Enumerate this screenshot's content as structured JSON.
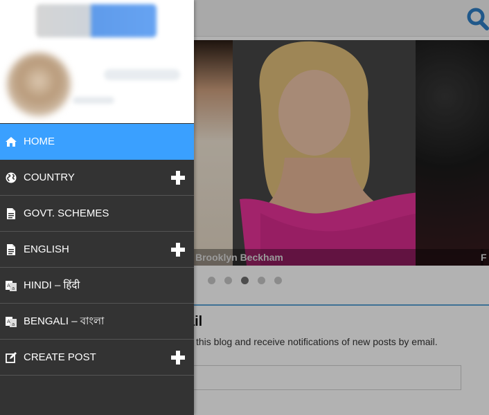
{
  "header": {
    "search_icon": "search-icon"
  },
  "slider": {
    "caption": "Brooklyn Beckham",
    "caption_next": "F",
    "dots_count": 5,
    "active_dot_index": 2
  },
  "follow": {
    "title": "ail",
    "description": "this blog and receive notifications of new posts by email.",
    "email_placeholder": ""
  },
  "drawer": {
    "menu": [
      {
        "label": "HOME",
        "icon": "home-icon",
        "active": true,
        "expandable": false
      },
      {
        "label": "COUNTRY",
        "icon": "globe-icon",
        "active": false,
        "expandable": true
      },
      {
        "label": "GOVT. SCHEMES",
        "icon": "document-icon",
        "active": false,
        "expandable": false
      },
      {
        "label": "ENGLISH",
        "icon": "document-icon",
        "active": false,
        "expandable": true
      },
      {
        "label": "HINDI – हिंदी",
        "icon": "translate-icon",
        "active": false,
        "expandable": false
      },
      {
        "label": "BENGALI – বাংলা",
        "icon": "translate-icon",
        "active": false,
        "expandable": false
      },
      {
        "label": "CREATE POST",
        "icon": "edit-icon",
        "active": false,
        "expandable": true
      }
    ]
  },
  "colors": {
    "accent": "#3aa0ff",
    "drawer_bg": "#333333",
    "search_icon": "#2f7fc6"
  }
}
